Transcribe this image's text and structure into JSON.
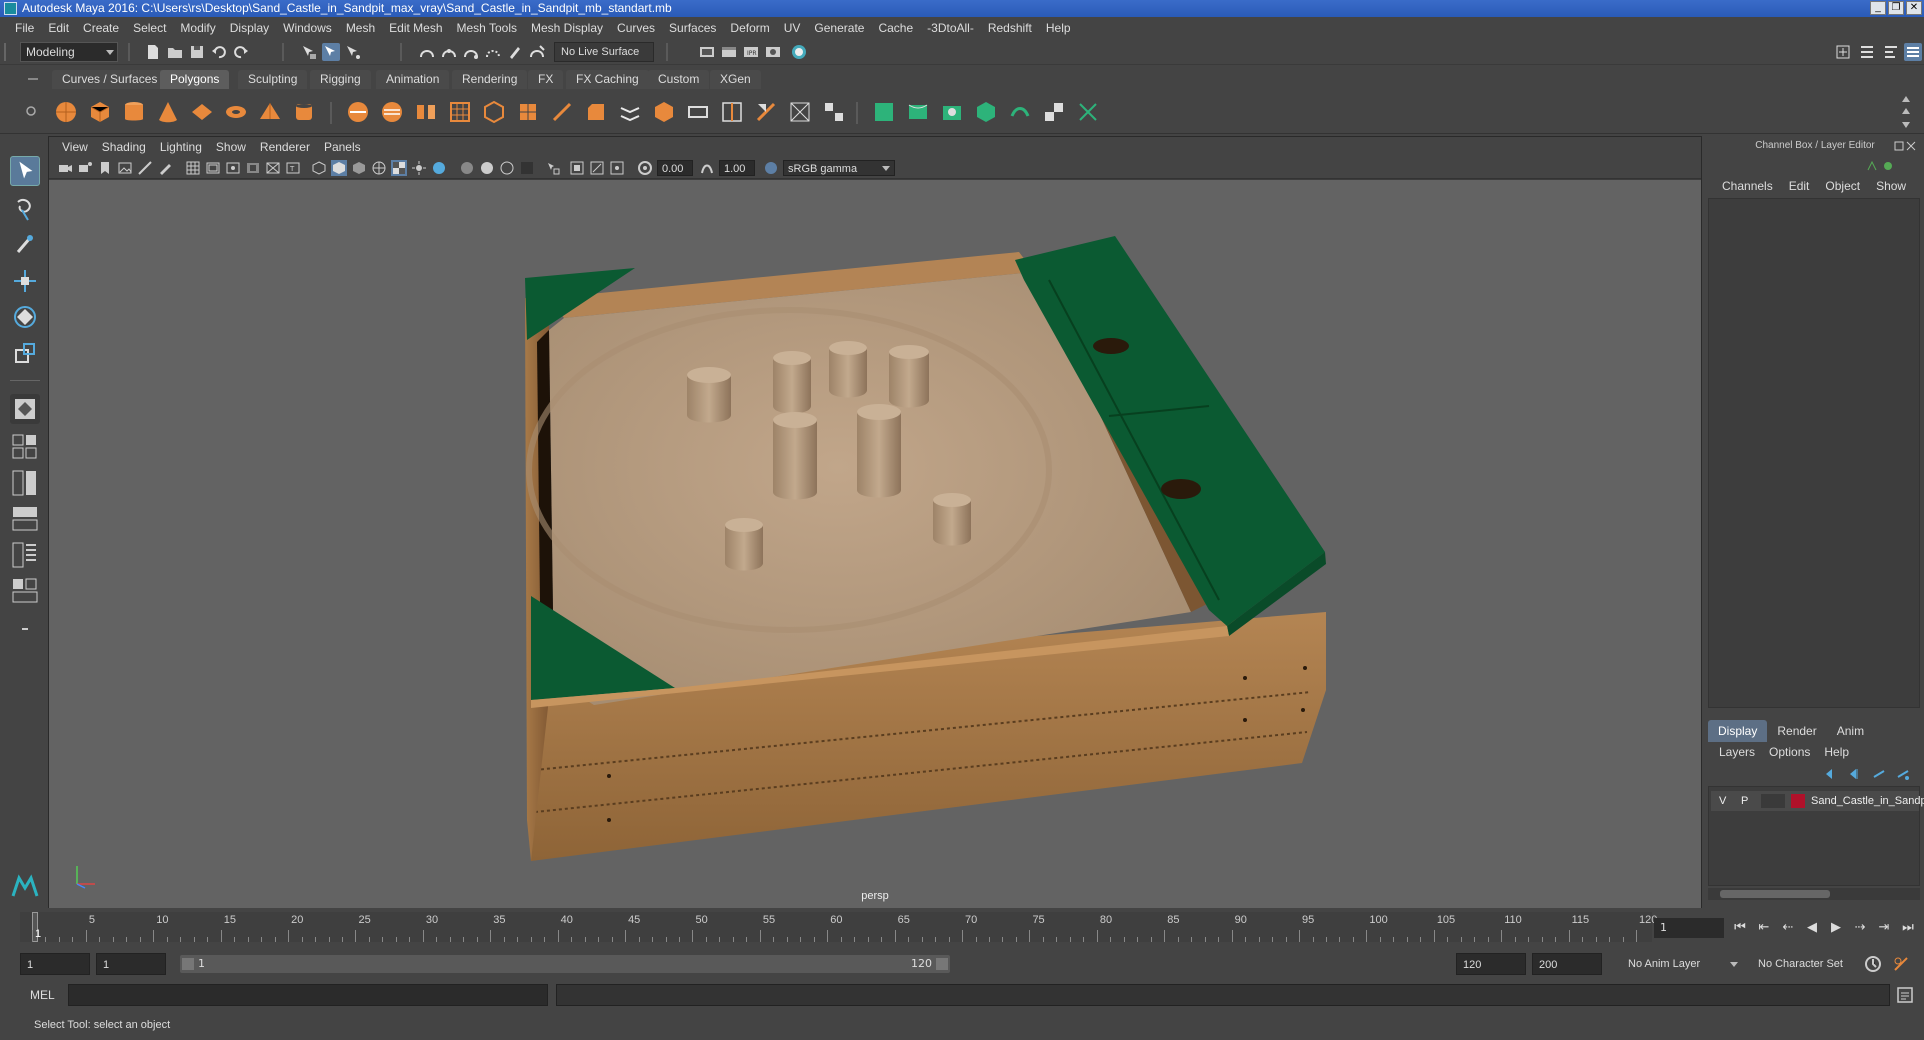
{
  "window": {
    "title": "Autodesk Maya 2016: C:\\Users\\rs\\Desktop\\Sand_Castle_in_Sandpit_max_vray\\Sand_Castle_in_Sandpit_mb_standart.mb"
  },
  "menubar": [
    "File",
    "Edit",
    "Create",
    "Select",
    "Modify",
    "Display",
    "Windows",
    "Mesh",
    "Edit Mesh",
    "Mesh Tools",
    "Mesh Display",
    "Curves",
    "Surfaces",
    "Deform",
    "UV",
    "Generate",
    "Cache",
    "-3DtoAll-",
    "Redshift",
    "Help"
  ],
  "statusline": {
    "mode": "Modeling",
    "live_surface": "No Live Surface"
  },
  "shelf": {
    "tabs": [
      "Curves / Surfaces",
      "Polygons",
      "Sculpting",
      "Rigging",
      "Animation",
      "Rendering",
      "FX",
      "FX Caching",
      "Custom",
      "XGen"
    ],
    "active_tab": "Polygons"
  },
  "viewport": {
    "menu": [
      "View",
      "Shading",
      "Lighting",
      "Show",
      "Renderer",
      "Panels"
    ],
    "exposure": "0.00",
    "gamma": "1.00",
    "color_space": "sRGB gamma",
    "camera": "persp"
  },
  "channel_box": {
    "title": "Channel Box / Layer Editor",
    "menu": [
      "Channels",
      "Edit",
      "Object",
      "Show"
    ]
  },
  "layer_editor": {
    "tabs": [
      "Display",
      "Render",
      "Anim"
    ],
    "active_tab": "Display",
    "menu": [
      "Layers",
      "Options",
      "Help"
    ],
    "layers": [
      {
        "v": "V",
        "p": "P",
        "name": "Sand_Castle_in_Sandp",
        "color": "#b0112a"
      }
    ]
  },
  "timeline": {
    "ticks": [
      "1",
      "5",
      "10",
      "15",
      "20",
      "25",
      "30",
      "35",
      "40",
      "45",
      "50",
      "55",
      "60",
      "65",
      "70",
      "75",
      "80",
      "85",
      "90",
      "95",
      "100",
      "105",
      "110",
      "115",
      "120"
    ],
    "current_frame": "1"
  },
  "range": {
    "start": "1",
    "inner_start": "1",
    "range_start_label": "1",
    "range_end_label": "120",
    "end": "120",
    "max_end": "200",
    "anim_layer": "No Anim Layer",
    "character_set": "No Character Set"
  },
  "command": {
    "label": "MEL"
  },
  "helpline": "Select Tool: select an object",
  "colors": {
    "accent": "#5d6f85",
    "sandpit_green": "#0b5a32",
    "wood": "#a67a45",
    "sand": "#b59a7e"
  }
}
